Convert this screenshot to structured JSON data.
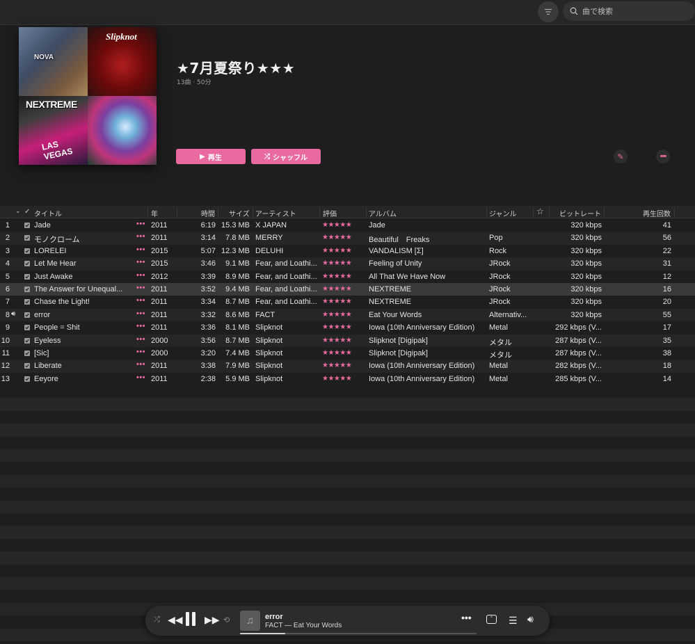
{
  "search": {
    "placeholder": "曲で検索",
    "icon": "search-icon"
  },
  "playlist": {
    "title": "★7月夏祭り★★★",
    "subtitle": "13曲 · 50分",
    "play_label": "再生",
    "shuffle_label": "シャッフル",
    "artwork": [
      "NOVA",
      "Slipknot",
      "NEXTREME",
      ""
    ],
    "artwork_extra": "LAS VEGAS"
  },
  "columns": {
    "title": "タイトル",
    "year": "年",
    "time": "時間",
    "size": "サイズ",
    "artist": "アーティスト",
    "rating": "評価",
    "album": "アルバム",
    "genre": "ジャンル",
    "bitrate": "ビットレート",
    "plays": "再生回数"
  },
  "tracks": [
    {
      "num": "1",
      "title": "Jade",
      "year": "2011",
      "time": "6:19",
      "size": "15.3 MB",
      "artist": "X JAPAN",
      "rating": "★★★★★",
      "album": "Jade",
      "genre": "",
      "bitrate": "320 kbps",
      "plays": "41"
    },
    {
      "num": "2",
      "title": "モノクローム",
      "year": "2011",
      "time": "3:14",
      "size": "7.8 MB",
      "artist": "MERRY",
      "rating": "★★★★★",
      "album": "Beautiful　Freaks",
      "genre": "Pop",
      "bitrate": "320 kbps",
      "plays": "56"
    },
    {
      "num": "3",
      "title": "LORELEI",
      "year": "2015",
      "time": "5:07",
      "size": "12.3 MB",
      "artist": "DELUHI",
      "rating": "★★★★★",
      "album": "VANDALISM [Σ]",
      "genre": "Rock",
      "bitrate": "320 kbps",
      "plays": "22"
    },
    {
      "num": "4",
      "title": "Let Me Hear",
      "year": "2015",
      "time": "3:46",
      "size": "9.1 MB",
      "artist": "Fear, and Loathi...",
      "rating": "★★★★★",
      "album": "Feeling of Unity",
      "genre": "JRock",
      "bitrate": "320 kbps",
      "plays": "31"
    },
    {
      "num": "5",
      "title": "Just Awake",
      "year": "2012",
      "time": "3:39",
      "size": "8.9 MB",
      "artist": "Fear, and Loathi...",
      "rating": "★★★★★",
      "album": "All That We Have Now",
      "genre": "JRock",
      "bitrate": "320 kbps",
      "plays": "12"
    },
    {
      "num": "6",
      "title": "The Answer for Unequal...",
      "year": "2011",
      "time": "3:52",
      "size": "9.4 MB",
      "artist": "Fear, and Loathi...",
      "rating": "★★★★★",
      "album": "NEXTREME",
      "genre": "JRock",
      "bitrate": "320 kbps",
      "plays": "16"
    },
    {
      "num": "7",
      "title": "Chase the Light!",
      "year": "2011",
      "time": "3:34",
      "size": "8.7 MB",
      "artist": "Fear, and Loathi...",
      "rating": "★★★★★",
      "album": "NEXTREME",
      "genre": "JRock",
      "bitrate": "320 kbps",
      "plays": "20"
    },
    {
      "num": "8",
      "title": "error",
      "year": "2011",
      "time": "3:32",
      "size": "8.6 MB",
      "artist": "FACT",
      "rating": "★★★★★",
      "album": "Eat Your Words",
      "genre": "Alternativ...",
      "bitrate": "320 kbps",
      "plays": "55"
    },
    {
      "num": "9",
      "title": "People = Shit",
      "year": "2011",
      "time": "3:36",
      "size": "8.1 MB",
      "artist": "Slipknot",
      "rating": "★★★★★",
      "album": "Iowa (10th Anniversary Edition)",
      "genre": "Metal",
      "bitrate": "292 kbps (V...",
      "plays": "17"
    },
    {
      "num": "10",
      "title": "Eyeless",
      "year": "2000",
      "time": "3:56",
      "size": "8.7 MB",
      "artist": "Slipknot",
      "rating": "★★★★★",
      "album": "Slipknot [Digipak]",
      "genre": "メタル",
      "bitrate": "287 kbps (V...",
      "plays": "35"
    },
    {
      "num": "11",
      "title": "[Sic]",
      "year": "2000",
      "time": "3:20",
      "size": "7.4 MB",
      "artist": "Slipknot",
      "rating": "★★★★★",
      "album": "Slipknot [Digipak]",
      "genre": "メタル",
      "bitrate": "287 kbps (V...",
      "plays": "38"
    },
    {
      "num": "12",
      "title": "Liberate",
      "year": "2011",
      "time": "3:38",
      "size": "7.9 MB",
      "artist": "Slipknot",
      "rating": "★★★★★",
      "album": "Iowa (10th Anniversary Edition)",
      "genre": "Metal",
      "bitrate": "282 kbps (V...",
      "plays": "18"
    },
    {
      "num": "13",
      "title": "Eeyore",
      "year": "2011",
      "time": "2:38",
      "size": "5.9 MB",
      "artist": "Slipknot",
      "rating": "★★★★★",
      "album": "Iowa (10th Anniversary Edition)",
      "genre": "Metal",
      "bitrate": "285 kbps (V...",
      "plays": "14"
    }
  ],
  "now_playing_index": 8,
  "selected_index": 6,
  "player": {
    "title": "error",
    "subtitle": "FACT — Eat Your Words",
    "progress": 0.19
  },
  "colors": {
    "accent": "#e86aa0",
    "background": "#1e1e1e",
    "row_alt": "#262626",
    "selected_row": "#3a3a3a"
  }
}
